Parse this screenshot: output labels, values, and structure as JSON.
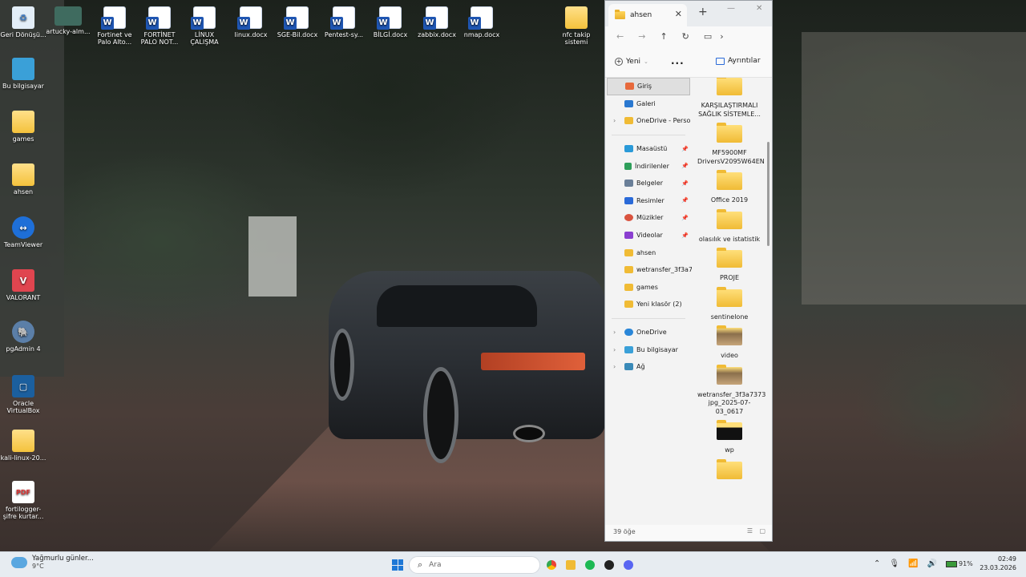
{
  "desktop": {
    "icons": [
      {
        "label": "Geri Dönüşü...",
        "icon": "recycle-bin-icon"
      },
      {
        "label": "artucky-alm...",
        "icon": "image-file-icon"
      },
      {
        "label": "Fortinet ve Palo Alto...",
        "icon": "word-document-icon"
      },
      {
        "label": "FORTİNET PALO NOT...",
        "icon": "word-document-icon"
      },
      {
        "label": "LİNUX ÇALIŞMA",
        "icon": "word-document-icon"
      },
      {
        "label": "linux.docx",
        "icon": "word-document-icon"
      },
      {
        "label": "SGE-Bil.docx",
        "icon": "word-document-icon"
      },
      {
        "label": "Pentest-sy...",
        "icon": "word-document-icon"
      },
      {
        "label": "BİLGİ.docx",
        "icon": "word-document-icon"
      },
      {
        "label": "zabbix.docx",
        "icon": "word-document-icon"
      },
      {
        "label": "nmap.docx",
        "icon": "word-document-icon"
      },
      {
        "label": "nfc takip sistemi",
        "icon": "folder-icon"
      },
      {
        "label": "Bu bilgisayar",
        "icon": "computer-icon"
      },
      {
        "label": "games",
        "icon": "folder-icon"
      },
      {
        "label": "ahsen",
        "icon": "folder-icon"
      },
      {
        "label": "TeamViewer",
        "icon": "teamviewer-icon"
      },
      {
        "label": "VALORANT",
        "icon": "valorant-icon"
      },
      {
        "label": "pgAdmin 4",
        "icon": "pgadmin-icon"
      },
      {
        "label": "Oracle VirtualBox",
        "icon": "virtualbox-icon"
      },
      {
        "label": "kali-linux-20...",
        "icon": "folder-icon"
      },
      {
        "label": "fortilogger-şifre kurtar...",
        "icon": "pdf-icon"
      }
    ]
  },
  "explorer": {
    "tab_title": "ahsen",
    "command_bar": {
      "new_label": "Yeni",
      "more_label": "...",
      "details_label": "Ayrıntılar"
    },
    "sidebar": [
      {
        "label": "Giriş",
        "icon": "home-icon",
        "selected": true
      },
      {
        "label": "Galeri",
        "icon": "gallery-icon"
      },
      {
        "label": "OneDrive - Perso",
        "icon": "folder-icon",
        "expandable": true
      },
      {
        "label": "Masaüstü",
        "icon": "desktop-icon",
        "pinned": true
      },
      {
        "label": "İndirilenler",
        "icon": "download-icon",
        "pinned": true
      },
      {
        "label": "Belgeler",
        "icon": "documents-icon",
        "pinned": true
      },
      {
        "label": "Resimler",
        "icon": "pictures-icon",
        "pinned": true
      },
      {
        "label": "Müzikler",
        "icon": "music-icon",
        "pinned": true
      },
      {
        "label": "Videolar",
        "icon": "videos-icon",
        "pinned": true
      },
      {
        "label": "ahsen",
        "icon": "folder-icon"
      },
      {
        "label": "wetransfer_3f3a7",
        "icon": "folder-icon"
      },
      {
        "label": "games",
        "icon": "folder-icon"
      },
      {
        "label": "Yeni klasör (2)",
        "icon": "folder-icon"
      },
      {
        "label": "OneDrive",
        "icon": "cloud-icon",
        "expandable": true
      },
      {
        "label": "Bu bilgisayar",
        "icon": "computer-icon",
        "expandable": true
      },
      {
        "label": "Ağ",
        "icon": "network-icon",
        "expandable": true
      }
    ],
    "items": [
      {
        "label": "KARŞILAŞTIRMALI SAĞLIK SİSTEMLE...",
        "style": "plain"
      },
      {
        "label": "MF5900MF DriversV2095W64EN",
        "style": "plain"
      },
      {
        "label": "Office 2019",
        "style": "plain"
      },
      {
        "label": "olasılık ve istatistik",
        "style": "plain"
      },
      {
        "label": "PROJE",
        "style": "plain"
      },
      {
        "label": "sentinelone",
        "style": "plain"
      },
      {
        "label": "video",
        "style": "pic"
      },
      {
        "label": "wetransfer_3f3a7373-jpg_2025-07-03_0617",
        "style": "pic"
      },
      {
        "label": "wp",
        "style": "dark"
      },
      {
        "label": "",
        "style": "plain"
      }
    ],
    "status": "39 öğe"
  },
  "taskbar": {
    "weather_title": "Yağmurlu günler...",
    "weather_temp": "9°C",
    "search_placeholder": "Ara",
    "battery": "91%",
    "time": "02:49",
    "date": "23.03.2026"
  },
  "colors": {
    "accent": "#1e78d6",
    "folder": "#f0bb35",
    "word": "#1f56b3"
  }
}
